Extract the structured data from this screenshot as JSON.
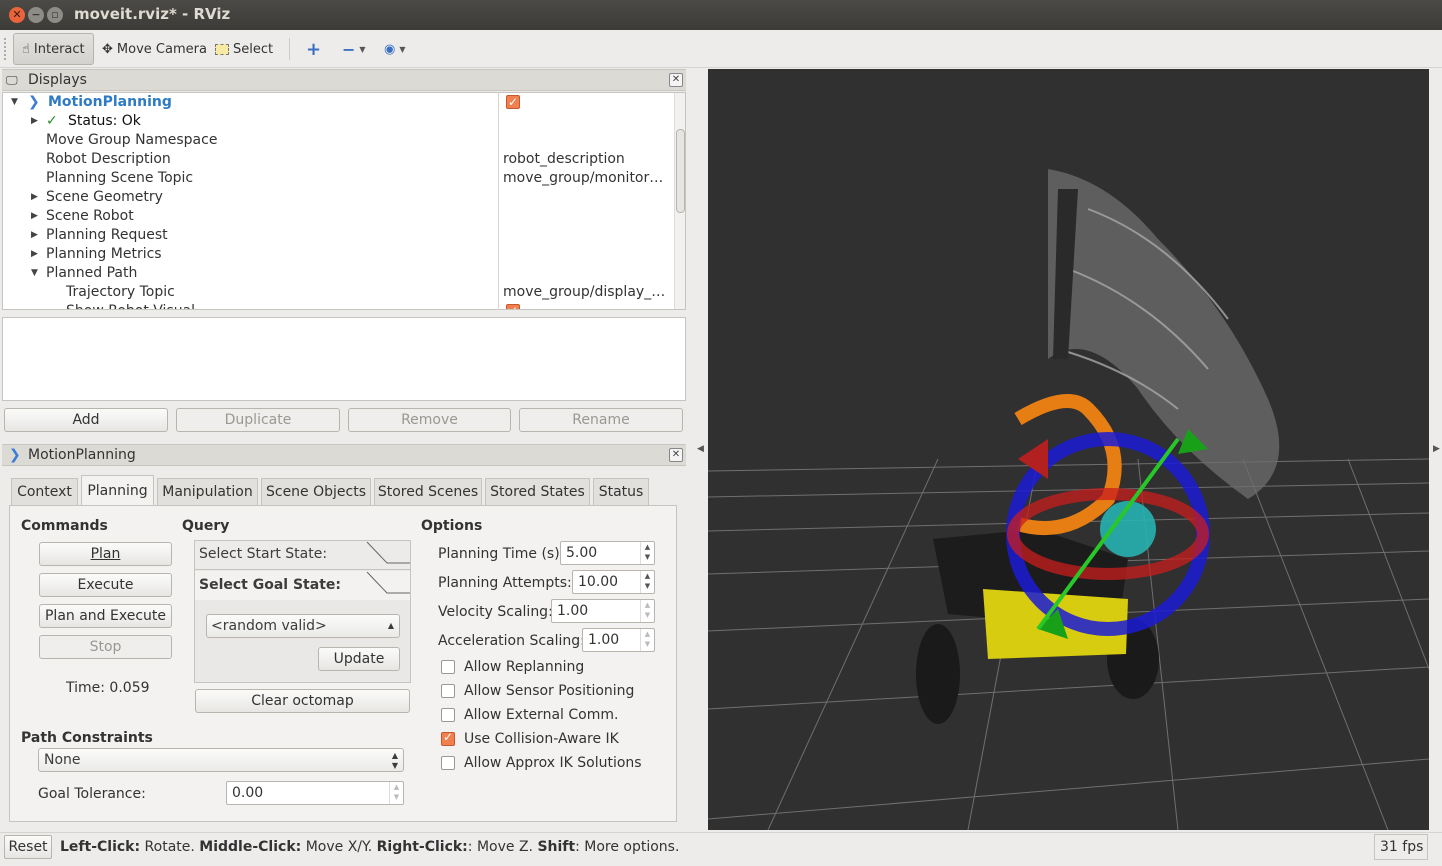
{
  "window": {
    "title": "moveit.rviz* - RViz"
  },
  "toolbar": {
    "interact": "Interact",
    "move_camera": "Move Camera",
    "select": "Select"
  },
  "displays": {
    "title": "Displays",
    "rows": [
      {
        "label": "MotionPlanning",
        "value": ""
      },
      {
        "label": "Status: Ok",
        "value": ""
      },
      {
        "label": "Move Group Namespace",
        "value": ""
      },
      {
        "label": "Robot Description",
        "value": "robot_description"
      },
      {
        "label": "Planning Scene Topic",
        "value": "move_group/monitor…"
      },
      {
        "label": "Scene Geometry",
        "value": ""
      },
      {
        "label": "Scene Robot",
        "value": ""
      },
      {
        "label": "Planning Request",
        "value": ""
      },
      {
        "label": "Planning Metrics",
        "value": ""
      },
      {
        "label": "Planned Path",
        "value": ""
      },
      {
        "label": "Trajectory Topic",
        "value": "move_group/display_…"
      },
      {
        "label": "Show Robot Visual",
        "value": ""
      }
    ],
    "buttons": {
      "add": "Add",
      "duplicate": "Duplicate",
      "remove": "Remove",
      "rename": "Rename"
    }
  },
  "motion_panel": {
    "title": "MotionPlanning",
    "tabs": [
      "Context",
      "Planning",
      "Manipulation",
      "Scene Objects",
      "Stored Scenes",
      "Stored States",
      "Status"
    ],
    "commands": {
      "heading": "Commands",
      "plan": "Plan",
      "execute": "Execute",
      "plan_execute": "Plan and Execute",
      "stop": "Stop",
      "time": "Time: 0.059"
    },
    "query": {
      "heading": "Query",
      "start": "Select Start State:",
      "goal": "Select Goal State:",
      "goal_value": "<random valid>",
      "update": "Update",
      "clear": "Clear octomap"
    },
    "options": {
      "heading": "Options",
      "planning_time_label": "Planning Time (s):",
      "planning_time": "5.00",
      "attempts_label": "Planning Attempts:",
      "attempts": "10.00",
      "velocity_label": "Velocity Scaling:",
      "velocity": "1.00",
      "accel_label": "Acceleration Scaling:",
      "accel": "1.00",
      "checks": [
        {
          "label": "Allow Replanning",
          "checked": false
        },
        {
          "label": "Allow Sensor Positioning",
          "checked": false
        },
        {
          "label": "Allow External Comm.",
          "checked": false
        },
        {
          "label": "Use Collision-Aware IK",
          "checked": true
        },
        {
          "label": "Allow Approx IK Solutions",
          "checked": false
        }
      ]
    },
    "path": {
      "heading": "Path Constraints",
      "value": "None",
      "tol_label": "Goal Tolerance:",
      "tol": "0.00"
    }
  },
  "status": {
    "reset": "Reset",
    "b1": "Left-Click:",
    "t1": " Rotate. ",
    "b2": "Middle-Click:",
    "t2": " Move X/Y. ",
    "b3": "Right-Click:",
    "t3": ": Move Z. ",
    "b4": "Shift",
    "t4": ": More options.",
    "fps": "31 fps"
  }
}
